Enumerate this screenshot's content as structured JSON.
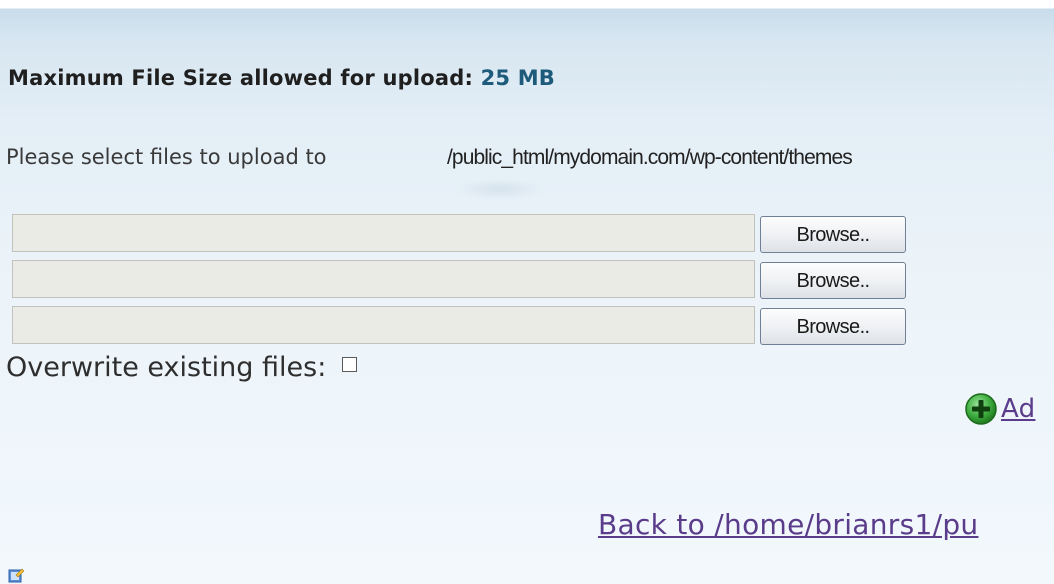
{
  "upload": {
    "max_size_label": "Maximum File Size allowed for upload:",
    "max_size_value": "25 MB",
    "select_label": "Please select files to upload to",
    "target_path": "/public_html/mydomain.com/wp-content/themes",
    "file_rows": [
      {
        "value": "",
        "browse_label": "Browse.."
      },
      {
        "value": "",
        "browse_label": "Browse.."
      },
      {
        "value": "",
        "browse_label": "Browse.."
      }
    ],
    "overwrite_label": "Overwrite existing files:",
    "overwrite_checked": false,
    "add_label": "Ad",
    "back_label": "Back to /home/brianrs1/pu"
  },
  "icons": {
    "add": "plus-circle-icon",
    "corner": "edit-pencil-icon"
  },
  "colors": {
    "size_value": "#1e5a7a",
    "link": "#5a3c8a",
    "add_icon": "#2e8b2e"
  }
}
